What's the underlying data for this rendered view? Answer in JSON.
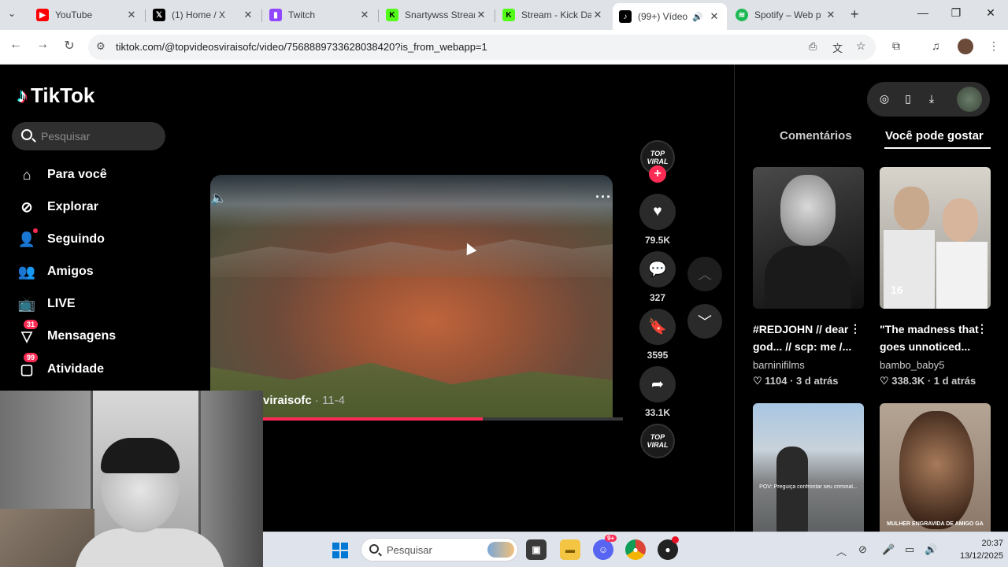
{
  "browser": {
    "tabs": [
      {
        "title": "YouTube",
        "favicon_color": "#ff0000"
      },
      {
        "title": "(1) Home / X",
        "favicon_color": "#000000"
      },
      {
        "title": "Twitch",
        "favicon_color": "#9146ff"
      },
      {
        "title": "Snartywss Stream",
        "favicon_color": "#53fc18"
      },
      {
        "title": "Stream - Kick Da",
        "favicon_color": "#53fc18"
      },
      {
        "title": "(99+) Vídeo",
        "favicon_color": "#000000",
        "active": true
      },
      {
        "title": "Spotify – Web p",
        "favicon_color": "#1db954"
      }
    ],
    "url": "tiktok.com/@topvideosviraisofc/video/7568889733628038420?is_from_webapp=1"
  },
  "tiktok": {
    "logo": "TikTok",
    "search_placeholder": "Pesquisar",
    "nav": [
      {
        "label": "Para você",
        "icon": "home-icon"
      },
      {
        "label": "Explorar",
        "icon": "compass-icon"
      },
      {
        "label": "Seguindo",
        "icon": "following-icon"
      },
      {
        "label": "Amigos",
        "icon": "friends-icon"
      },
      {
        "label": "LIVE",
        "icon": "live-icon"
      },
      {
        "label": "Mensagens",
        "icon": "messages-icon",
        "badge": "31"
      },
      {
        "label": "Atividade",
        "icon": "activity-icon",
        "badge": "99"
      }
    ],
    "video": {
      "author": "viraisofc",
      "date": "· 11-4",
      "progress_fraction": 0.61
    },
    "avatar_text": "TOP VIRAL",
    "actions": {
      "likes": "79.5K",
      "comments": "327",
      "saves": "3595",
      "shares": "33.1K"
    },
    "right_tabs": {
      "comments": "Comentários",
      "suggested": "Você pode gostar"
    },
    "suggestions": [
      {
        "title": "#REDJOHN // dear god... // scp: me /...",
        "author": "barninifilms",
        "likes": "1104",
        "time": "3 d atrás"
      },
      {
        "title": "\"The madness that goes unnoticed...",
        "author": "bambo_baby5",
        "likes": "338.3K",
        "time": "1 d atrás",
        "overlay": "16"
      },
      {
        "title": "",
        "author": "",
        "likes": "",
        "time": "",
        "overlay": "POV: Preguiça confrontar seu criminal..."
      },
      {
        "title": "",
        "author": "",
        "likes": "",
        "time": "",
        "overlay": "MULHER ENGRAVIDA DE AMIGO GA"
      }
    ]
  },
  "taskbar": {
    "search_label": "Pesquisar",
    "time": "20:37",
    "date": "13/12/2025",
    "chat_badge": "9+"
  }
}
